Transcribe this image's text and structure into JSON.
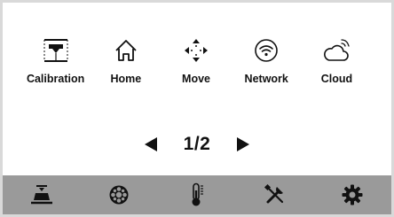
{
  "tools": [
    {
      "label": "Calibration",
      "icon": "calibration-icon"
    },
    {
      "label": "Home",
      "icon": "home-icon"
    },
    {
      "label": "Move",
      "icon": "move-icon"
    },
    {
      "label": "Network",
      "icon": "wifi-icon"
    },
    {
      "label": "Cloud",
      "icon": "cloud-icon"
    }
  ],
  "pager": {
    "page": "1/2",
    "prev_icon": "left-arrow-icon",
    "next_icon": "right-arrow-icon"
  },
  "navbar": {
    "items": [
      {
        "icon": "print-bed-icon"
      },
      {
        "icon": "filament-spool-icon"
      },
      {
        "icon": "thermometer-icon"
      },
      {
        "icon": "tools-icon"
      },
      {
        "icon": "settings-gear-icon"
      }
    ]
  },
  "colors": {
    "background": "#ffffff",
    "navbar": "#9a9a9a",
    "icon": "#111111",
    "frame": "#d9d9d9"
  }
}
